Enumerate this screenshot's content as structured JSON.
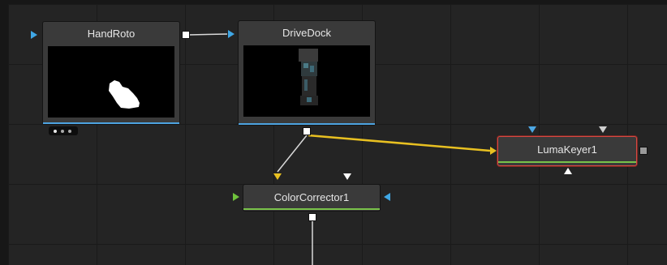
{
  "nodes": {
    "handroto": {
      "title": "HandRoto"
    },
    "drivedock": {
      "title": "DriveDock"
    },
    "colorcorrector": {
      "title": "ColorCorrector1"
    },
    "lumakeyer": {
      "title": "LumaKeyer1"
    }
  },
  "colors": {
    "canvas": "#242424",
    "node": "#3a3a3a",
    "input_blue": "#3fa7e5",
    "input_yellow": "#e8c021",
    "input_green": "#6fc23c",
    "wire_active": "#e8c021",
    "selected_outline": "#d64a43"
  }
}
